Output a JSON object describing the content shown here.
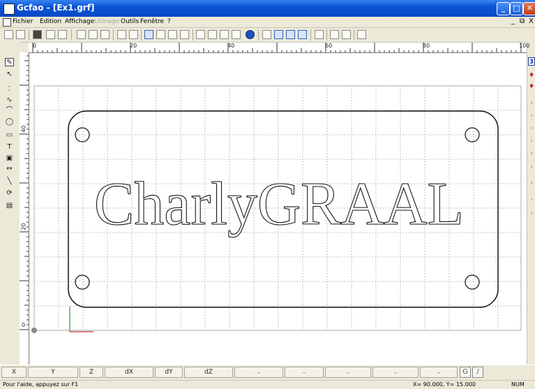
{
  "window": {
    "title": "Gcfao - [Ex1.grf]",
    "minimize": "_",
    "maximize": "□",
    "close": "✕"
  },
  "menu": {
    "items": [
      "Fichier",
      "Edition",
      "Affichage",
      "Usinage",
      "Outils",
      "Fenêtre",
      "?"
    ],
    "disabled": [
      false,
      false,
      false,
      true,
      false,
      false,
      false
    ],
    "mdi_minimize": "_",
    "mdi_restore": "⧉",
    "mdi_close": "X"
  },
  "ruler": {
    "h_labels": [
      "0",
      "20",
      "40",
      "60",
      "80",
      "100"
    ],
    "v_labels": [
      "40",
      "20",
      "0"
    ]
  },
  "drawing": {
    "text": "CharlyGRAAL"
  },
  "coords": {
    "labels": [
      "X",
      "Y",
      "Z",
      "dX",
      "dY",
      "dZ"
    ],
    "dropdown_glyph": "⌄"
  },
  "status": {
    "help": "Pour l'aide, appuyez sur F1",
    "position": "X= 90.000, Y= 15.000",
    "mode": "NUM"
  },
  "colors": {
    "titlebar": "#0a55d8",
    "chrome": "#ece9d8",
    "grid": "#c0c0c0",
    "axis_x": "#cc3333",
    "axis_y": "#2a9a2a"
  },
  "icons": [
    "new-icon",
    "open-icon",
    "save-icon",
    "print-icon",
    "print-preview-icon",
    "cut-icon",
    "copy-icon",
    "paste-icon",
    "undo-icon",
    "redo-icon",
    "select-icon",
    "zoom-in-icon",
    "zoom-out-icon",
    "zoom-all-icon",
    "layer-icon",
    "group-icon",
    "ungroup-icon",
    "properties-icon",
    "globe-icon",
    "cube-icon",
    "view-xy-icon",
    "view-xz-icon",
    "view-yz-icon",
    "machine-icon",
    "simulate-icon",
    "export-icon",
    "help-pointer-icon"
  ]
}
